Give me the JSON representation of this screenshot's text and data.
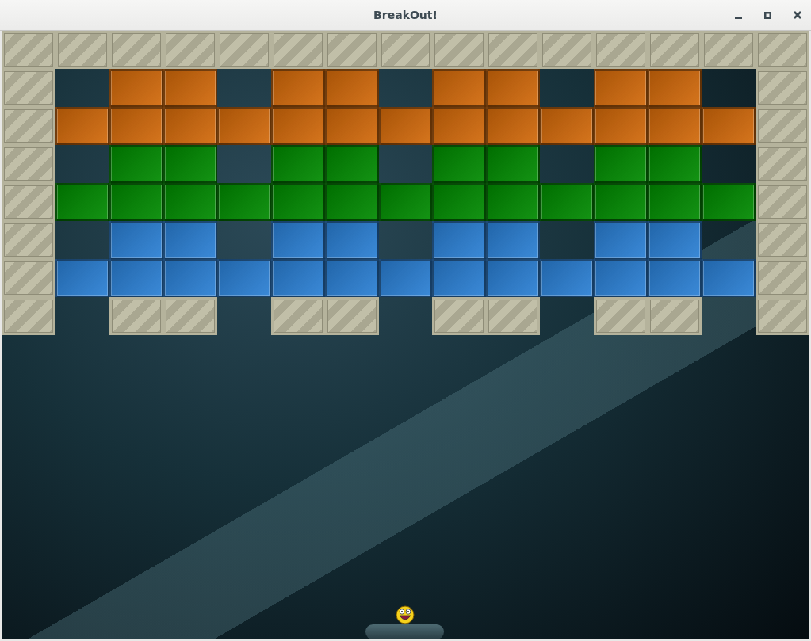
{
  "window": {
    "title": "BreakOut!"
  },
  "rows": [
    {
      "cells": [
        {
          "kind": "stone"
        },
        {
          "kind": "stone"
        },
        {
          "kind": "stone"
        },
        {
          "kind": "stone"
        },
        {
          "kind": "stone"
        },
        {
          "kind": "stone"
        },
        {
          "kind": "stone"
        },
        {
          "kind": "stone"
        },
        {
          "kind": "stone"
        },
        {
          "kind": "stone"
        },
        {
          "kind": "stone"
        },
        {
          "kind": "stone"
        },
        {
          "kind": "stone"
        },
        {
          "kind": "stone"
        },
        {
          "kind": "stone"
        }
      ]
    },
    {
      "cells": [
        {
          "kind": "stone"
        },
        {
          "kind": "empty"
        },
        {
          "kind": "brick",
          "color": "#d2690a"
        },
        {
          "kind": "brick",
          "color": "#d2690a"
        },
        {
          "kind": "empty"
        },
        {
          "kind": "brick",
          "color": "#d2690a"
        },
        {
          "kind": "brick",
          "color": "#d2690a"
        },
        {
          "kind": "empty"
        },
        {
          "kind": "brick",
          "color": "#d2690a"
        },
        {
          "kind": "brick",
          "color": "#d2690a"
        },
        {
          "kind": "empty"
        },
        {
          "kind": "brick",
          "color": "#d2690a"
        },
        {
          "kind": "brick",
          "color": "#d2690a"
        },
        {
          "kind": "empty"
        },
        {
          "kind": "stone"
        }
      ]
    },
    {
      "cells": [
        {
          "kind": "stone"
        },
        {
          "kind": "brick",
          "color": "#d2690a"
        },
        {
          "kind": "brick",
          "color": "#d2690a"
        },
        {
          "kind": "brick",
          "color": "#d2690a"
        },
        {
          "kind": "brick",
          "color": "#d2690a"
        },
        {
          "kind": "brick",
          "color": "#d2690a"
        },
        {
          "kind": "brick",
          "color": "#d2690a"
        },
        {
          "kind": "brick",
          "color": "#d2690a"
        },
        {
          "kind": "brick",
          "color": "#d2690a"
        },
        {
          "kind": "brick",
          "color": "#d2690a"
        },
        {
          "kind": "brick",
          "color": "#d2690a"
        },
        {
          "kind": "brick",
          "color": "#d2690a"
        },
        {
          "kind": "brick",
          "color": "#d2690a"
        },
        {
          "kind": "brick",
          "color": "#d2690a"
        },
        {
          "kind": "stone"
        }
      ]
    },
    {
      "cells": [
        {
          "kind": "stone"
        },
        {
          "kind": "empty"
        },
        {
          "kind": "brick",
          "color": "#008a00"
        },
        {
          "kind": "brick",
          "color": "#008a00"
        },
        {
          "kind": "empty"
        },
        {
          "kind": "brick",
          "color": "#008a00"
        },
        {
          "kind": "brick",
          "color": "#008a00"
        },
        {
          "kind": "empty"
        },
        {
          "kind": "brick",
          "color": "#008a00"
        },
        {
          "kind": "brick",
          "color": "#008a00"
        },
        {
          "kind": "empty"
        },
        {
          "kind": "brick",
          "color": "#008a00"
        },
        {
          "kind": "brick",
          "color": "#008a00"
        },
        {
          "kind": "empty"
        },
        {
          "kind": "stone"
        }
      ]
    },
    {
      "cells": [
        {
          "kind": "stone"
        },
        {
          "kind": "brick",
          "color": "#008a00"
        },
        {
          "kind": "brick",
          "color": "#008a00"
        },
        {
          "kind": "brick",
          "color": "#008a00"
        },
        {
          "kind": "brick",
          "color": "#008a00"
        },
        {
          "kind": "brick",
          "color": "#008a00"
        },
        {
          "kind": "brick",
          "color": "#008a00"
        },
        {
          "kind": "brick",
          "color": "#008a00"
        },
        {
          "kind": "brick",
          "color": "#008a00"
        },
        {
          "kind": "brick",
          "color": "#008a00"
        },
        {
          "kind": "brick",
          "color": "#008a00"
        },
        {
          "kind": "brick",
          "color": "#008a00"
        },
        {
          "kind": "brick",
          "color": "#008a00"
        },
        {
          "kind": "brick",
          "color": "#008a00"
        },
        {
          "kind": "stone"
        }
      ]
    },
    {
      "cells": [
        {
          "kind": "stone"
        },
        {
          "kind": "empty"
        },
        {
          "kind": "brick",
          "color": "#2a7fd4"
        },
        {
          "kind": "brick",
          "color": "#2a7fd4"
        },
        {
          "kind": "empty"
        },
        {
          "kind": "brick",
          "color": "#2a7fd4"
        },
        {
          "kind": "brick",
          "color": "#2a7fd4"
        },
        {
          "kind": "empty"
        },
        {
          "kind": "brick",
          "color": "#2a7fd4"
        },
        {
          "kind": "brick",
          "color": "#2a7fd4"
        },
        {
          "kind": "empty"
        },
        {
          "kind": "brick",
          "color": "#2a7fd4"
        },
        {
          "kind": "brick",
          "color": "#2a7fd4"
        },
        {
          "kind": "empty"
        },
        {
          "kind": "stone"
        }
      ]
    },
    {
      "cells": [
        {
          "kind": "stone"
        },
        {
          "kind": "brick",
          "color": "#2a7fd4"
        },
        {
          "kind": "brick",
          "color": "#2a7fd4"
        },
        {
          "kind": "brick",
          "color": "#2a7fd4"
        },
        {
          "kind": "brick",
          "color": "#2a7fd4"
        },
        {
          "kind": "brick",
          "color": "#2a7fd4"
        },
        {
          "kind": "brick",
          "color": "#2a7fd4"
        },
        {
          "kind": "brick",
          "color": "#2a7fd4"
        },
        {
          "kind": "brick",
          "color": "#2a7fd4"
        },
        {
          "kind": "brick",
          "color": "#2a7fd4"
        },
        {
          "kind": "brick",
          "color": "#2a7fd4"
        },
        {
          "kind": "brick",
          "color": "#2a7fd4"
        },
        {
          "kind": "brick",
          "color": "#2a7fd4"
        },
        {
          "kind": "brick",
          "color": "#2a7fd4"
        },
        {
          "kind": "stone"
        }
      ]
    },
    {
      "cells": [
        {
          "kind": "stone"
        },
        {
          "kind": "empty"
        },
        {
          "kind": "stone"
        },
        {
          "kind": "stone"
        },
        {
          "kind": "empty"
        },
        {
          "kind": "stone"
        },
        {
          "kind": "stone"
        },
        {
          "kind": "empty"
        },
        {
          "kind": "stone"
        },
        {
          "kind": "stone"
        },
        {
          "kind": "empty"
        },
        {
          "kind": "stone"
        },
        {
          "kind": "stone"
        },
        {
          "kind": "empty"
        },
        {
          "kind": "stone"
        }
      ]
    }
  ]
}
